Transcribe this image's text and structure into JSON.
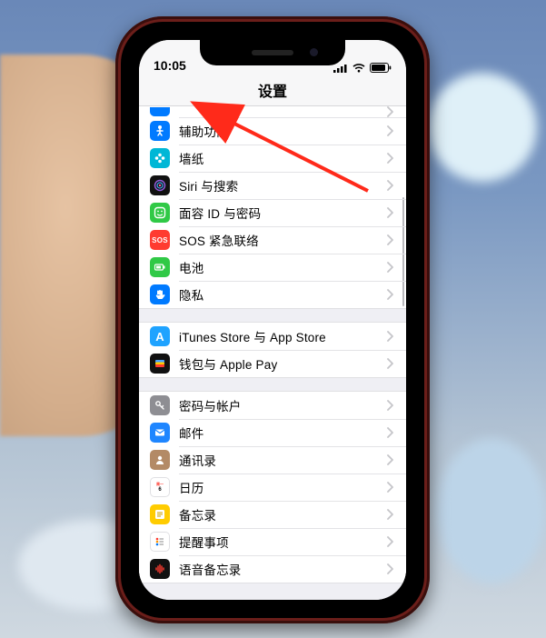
{
  "status": {
    "time": "10:05"
  },
  "nav": {
    "title": "设置"
  },
  "groups": [
    {
      "id": "general",
      "partialTop": true,
      "rows": [
        {
          "id": "accessibility",
          "label": "辅助功能",
          "icon": "accessibility-icon",
          "iconClass": "c-blue",
          "glyph": "figure"
        },
        {
          "id": "wallpaper",
          "label": "墙纸",
          "icon": "wallpaper-icon",
          "iconClass": "c-cyan",
          "glyph": "flower"
        },
        {
          "id": "siri",
          "label": "Siri 与搜索",
          "icon": "siri-icon",
          "iconClass": "c-black",
          "glyph": "siri"
        },
        {
          "id": "faceid",
          "label": "面容 ID 与密码",
          "icon": "faceid-icon",
          "iconClass": "c-green",
          "glyph": "face"
        },
        {
          "id": "sos",
          "label": "SOS 紧急联络",
          "icon": "sos-icon",
          "iconClass": "c-red",
          "glyph": "sos"
        },
        {
          "id": "battery",
          "label": "电池",
          "icon": "battery-icon",
          "iconClass": "c-green",
          "glyph": "batt"
        },
        {
          "id": "privacy",
          "label": "隐私",
          "icon": "privacy-icon",
          "iconClass": "c-priv",
          "glyph": "hand"
        }
      ]
    },
    {
      "id": "store",
      "rows": [
        {
          "id": "appstore",
          "label": "iTunes Store 与 App Store",
          "icon": "appstore-icon",
          "iconClass": "c-as",
          "glyph": "A"
        },
        {
          "id": "wallet",
          "label": "钱包与 Apple Pay",
          "icon": "wallet-icon",
          "iconClass": "c-wallet",
          "glyph": "wallet"
        }
      ]
    },
    {
      "id": "accounts",
      "rows": [
        {
          "id": "passwords",
          "label": "密码与帐户",
          "icon": "passwords-icon",
          "iconClass": "c-gray",
          "glyph": "key"
        },
        {
          "id": "mail",
          "label": "邮件",
          "icon": "mail-icon",
          "iconClass": "c-mail",
          "glyph": "mail"
        },
        {
          "id": "contacts",
          "label": "通讯录",
          "icon": "contacts-icon",
          "iconClass": "c-contacts",
          "glyph": "person"
        },
        {
          "id": "calendar",
          "label": "日历",
          "icon": "calendar-icon",
          "iconClass": "c-cal",
          "glyph": "cal"
        },
        {
          "id": "notes",
          "label": "备忘录",
          "icon": "notes-icon",
          "iconClass": "c-notes",
          "glyph": "notes"
        },
        {
          "id": "reminders",
          "label": "提醒事项",
          "icon": "reminders-icon",
          "iconClass": "c-rem",
          "glyph": "rem"
        },
        {
          "id": "voicememos",
          "label": "语音备忘录",
          "icon": "voicememos-icon",
          "iconClass": "c-voice",
          "glyph": "wave"
        }
      ]
    }
  ],
  "annotation": {
    "targetRowId": "accessibility"
  }
}
